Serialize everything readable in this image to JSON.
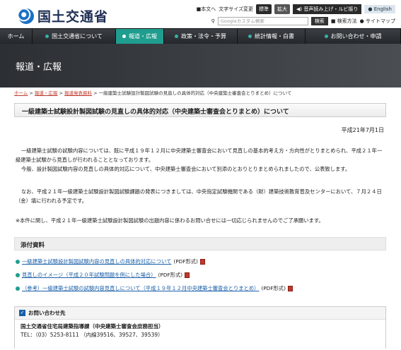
{
  "header": {
    "logo_text": "国土交通省",
    "utility": {
      "main_text": "本文へ",
      "text_size_label": "文字サイズ変更",
      "standard": "標準",
      "enlarge": "拡大",
      "voice": "音声読み上げ・ルビ振り",
      "english": "English"
    },
    "search": {
      "placeholder": "Googleカスタム検索",
      "button": "検索",
      "method": "検索方法",
      "sitemap": "サイトマップ"
    }
  },
  "nav": [
    {
      "label": "ホーム",
      "active": false
    },
    {
      "label": "国土交通省について",
      "active": false
    },
    {
      "label": "報道・広報",
      "active": true
    },
    {
      "label": "政策・法令・予算",
      "active": false
    },
    {
      "label": "統計情報・白書",
      "active": false
    },
    {
      "label": "お問い合わせ・申請",
      "active": false
    }
  ],
  "hero_title": "報道・広報",
  "breadcrumb": {
    "home": "ホーム",
    "sep": ">",
    "press": "報道・広報",
    "release": "報道発表資料",
    "current": "一級建築士試験設計製図試験の見直しの具体的対応（中央建築士審査会とりまとめ）について"
  },
  "page_title": "一級建築士試験設計製図試験の見直しの具体的対応（中央建築士審査会とりまとめ）について",
  "date": "平成21年7月1日",
  "paragraphs": {
    "p1": "一級建築士試験の試験内容については、既に平成１９年１２月に中央建築士審査会において見直しの基本的考え方・方向性がとりまとめられ、平成２１年一級建築士試験から見直しが行われることとなっております。",
    "p2": "今般、設計製図試験内容の見直しの具体的対応について、中央建築士審査会において別添のとおりとりまとめられましたので、公表致します。",
    "p3": "なお、平成２１年一級建築士試験設計製図試験課題の発表につきましては、中央指定試験機関である（財）建築技術教育普及センターにおいて、７月２４日（金）填に行われる予定です。",
    "p4": "※本件に関し、平成２１年一級建築士試験設計製図試験の出題内容に係わるお問い合せには一切応じられませんのでご了承願います。"
  },
  "attachments": {
    "heading": "添付資料",
    "items": [
      {
        "label": "一級建築士試験設計製図試験内容の見直しの具体的対応について",
        "format": "(PDF形式)"
      },
      {
        "label": "見直しのイメージ（平成２０年試験問題を例にした場合）",
        "format": "(PDF形式)"
      },
      {
        "label": "（参考）一級建築士試験の試験内容見直しについて（平成１９年１２月中央建築士審査会とりまとめ）",
        "format": "(PDF形式)"
      }
    ]
  },
  "contact": {
    "heading": "お問い合わせ先",
    "org": "国土交通省住宅局建築指導課（中央建築士審査会庶務担当）",
    "tel": "TEL：（03）5253-8111 （内線39516、39527、39539）"
  }
}
